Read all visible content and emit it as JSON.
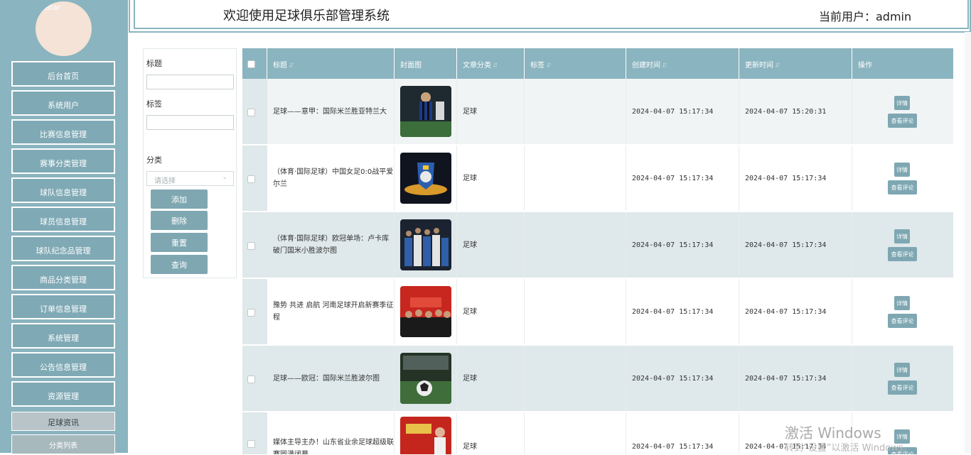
{
  "sidebar": {
    "avatar_alt": "avatar",
    "items": [
      {
        "label": "后台首页"
      },
      {
        "label": "系统用户"
      },
      {
        "label": "比赛信息管理"
      },
      {
        "label": "赛事分类管理"
      },
      {
        "label": "球队信息管理"
      },
      {
        "label": "球员信息管理"
      },
      {
        "label": "球队纪念品管理"
      },
      {
        "label": "商品分类管理"
      },
      {
        "label": "订单信息管理"
      },
      {
        "label": "系统管理"
      },
      {
        "label": "公告信息管理"
      },
      {
        "label": "资源管理"
      }
    ],
    "active_item": "足球资讯",
    "sub_item": "分类列表"
  },
  "header": {
    "title": "欢迎使用足球俱乐部管理系统",
    "user_text": "当前用户：admin"
  },
  "filter": {
    "title_label": "标题",
    "tag_label": "标签",
    "category_label": "分类",
    "category_placeholder": "请选择",
    "add_label": "添加",
    "delete_label": "删除",
    "reset_label": "重置",
    "query_label": "查询"
  },
  "table": {
    "columns": {
      "title": "标题",
      "cover": "封面图",
      "category": "文章分类",
      "tags": "标签",
      "created": "创建时间",
      "updated": "更新时间",
      "actions": "操作"
    },
    "detail_label": "详情",
    "comment_label": "查看评论",
    "rows": [
      {
        "title": "足球——意甲：国际米兰胜亚特兰大",
        "category": "足球",
        "tags": "",
        "created": "2024-04-07 15:17:34",
        "updated": "2024-04-07 15:20:31"
      },
      {
        "title": "（体育·国际足球）中国女足0:0战平爱尔兰",
        "category": "足球",
        "tags": "",
        "created": "2024-04-07 15:17:34",
        "updated": "2024-04-07 15:17:34"
      },
      {
        "title": "（体育·国际足球）欧冠单场：卢卡库破门国米小胜波尔图",
        "category": "足球",
        "tags": "",
        "created": "2024-04-07 15:17:34",
        "updated": "2024-04-07 15:17:34"
      },
      {
        "title": "豫势 共进 启航 河南足球开启新赛季征程",
        "category": "足球",
        "tags": "",
        "created": "2024-04-07 15:17:34",
        "updated": "2024-04-07 15:17:34"
      },
      {
        "title": "足球——欧冠：国际米兰胜波尔图",
        "category": "足球",
        "tags": "",
        "created": "2024-04-07 15:17:34",
        "updated": "2024-04-07 15:17:34"
      },
      {
        "title": "媒体主导主办！山东省业余足球超级联赛圆满闭幕",
        "category": "足球",
        "tags": "",
        "created": "2024-04-07 15:17:34",
        "updated": "2024-04-07 15:17:34"
      }
    ]
  },
  "watermark": {
    "line1": "激活 Windows",
    "line2": "转到“设置”以激活 Windows。"
  }
}
